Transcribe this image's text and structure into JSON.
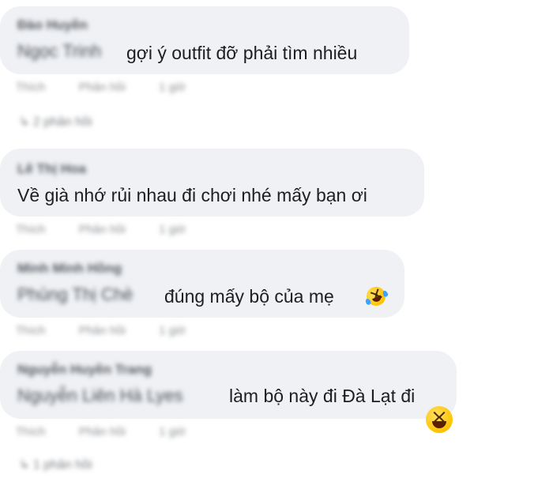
{
  "comments": [
    {
      "author": "Đào Huyền",
      "mention": "Ngọc Trinh",
      "text": "gợi ý outfit đỡ phải tìm nhiều",
      "actions": [
        "Thích",
        "Phản hồi",
        "1 giờ"
      ],
      "replies": "2 phản hồi"
    },
    {
      "author": "Lê Thị Hoa",
      "mention": "",
      "text": "Về già nhớ rủi nhau đi chơi nhé mấy bạn ơi",
      "actions": [
        "Thích",
        "Phản hồi",
        "1 giờ"
      ],
      "replies": ""
    },
    {
      "author": "Minh Minh Hồng",
      "mention": "Phùng Thị Chè",
      "text": "đúng mấy bộ của mẹ",
      "actions": [
        "Thích",
        "Phản hồi",
        "1 giờ"
      ],
      "replies": ""
    },
    {
      "author": "Nguyễn Huyền Trang",
      "mention": "Nguyễn Liên Hà Lyes",
      "text": "làm bộ này đi Đà Lạt đi",
      "actions": [
        "Thích",
        "Phản hồi",
        "1 giờ"
      ],
      "replies": "1 phản hồi"
    }
  ],
  "emojis": {
    "comment3": "rolling-on-floor-laughing-icon",
    "comment4": "grinning-squinting-face-icon"
  }
}
